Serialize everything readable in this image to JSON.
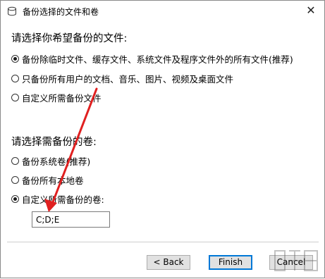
{
  "window": {
    "title": "备份选择的文件和卷",
    "close_symbol": "✕"
  },
  "files_section": {
    "heading": "请选择你希望备份的文件:",
    "options": [
      {
        "label": "备份除临时文件、缓存文件、系统文件及程序文件外的所有文件(推荐)",
        "checked": true
      },
      {
        "label": "只备份所有用户的文档、音乐、图片、视频及桌面文件",
        "checked": false
      },
      {
        "label": "自定义所需备份文件",
        "checked": false
      }
    ]
  },
  "volumes_section": {
    "heading": "请选择需备份的卷:",
    "options": [
      {
        "label": "备份系统卷(推荐)",
        "checked": false
      },
      {
        "label": "备份所有本地卷",
        "checked": false
      },
      {
        "label": "自定义所需备份的卷:",
        "checked": true
      }
    ],
    "custom_volumes_value": "C;D;E"
  },
  "buttons": {
    "back": "< Back",
    "finish": "Finish",
    "cancel": "Cancel"
  },
  "colors": {
    "annotation_arrow": "#e02020",
    "default_button_border": "#0078d7"
  },
  "icons": {
    "title": "disk-icon",
    "close": "close-icon"
  }
}
